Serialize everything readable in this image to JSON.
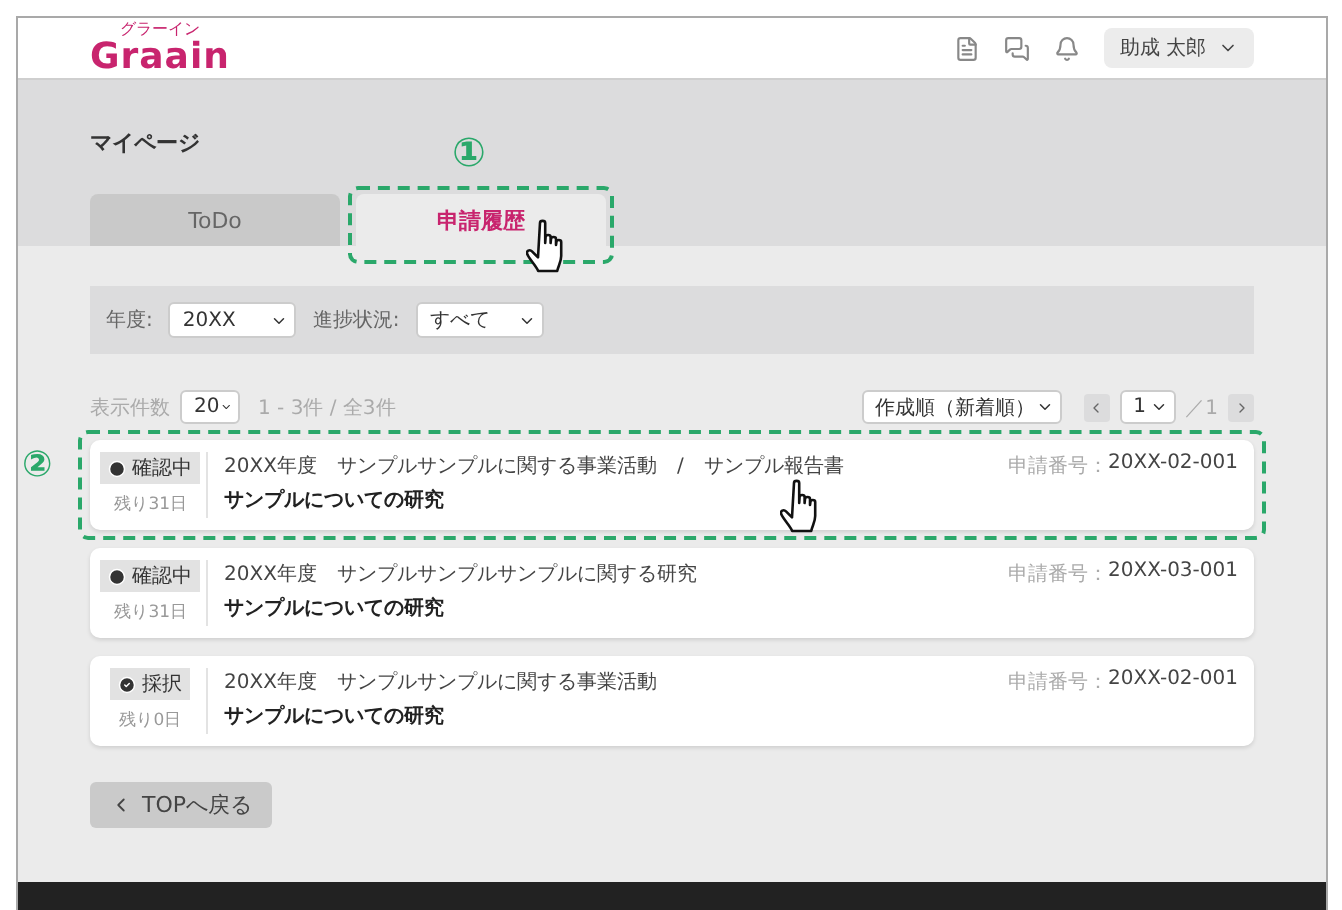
{
  "header": {
    "logo": "Graain",
    "logo_reading": "グラーイン",
    "user_menu": "助成 太郎"
  },
  "page_title": "マイページ",
  "tabs": [
    {
      "label": "ToDo",
      "selected": false
    },
    {
      "label": "申請履歴",
      "selected": true,
      "marker": "①"
    }
  ],
  "filters": [
    {
      "label": "年度:",
      "value": "20XX"
    },
    {
      "label": "進捗状況:",
      "value": "すべて"
    }
  ],
  "list_controls": {
    "per_page_label": "表示件数",
    "per_page": "20",
    "range": "1 - 3件 / 全3件",
    "sort": "作成順（新着順）",
    "page": "1",
    "page_total": "／1"
  },
  "applications": [
    {
      "kind": "pending",
      "status": "確認中",
      "remaining": "残り31日",
      "meta": [
        "20XX年度",
        "サンプルサンプルに関する事業活動",
        "/",
        "サンプル報告書"
      ],
      "title": "サンプルについての研究",
      "number_label": "申請番号：",
      "number": "20XX-02-001",
      "marker": "②"
    },
    {
      "kind": "pending",
      "status": "確認中",
      "remaining": "残り31日",
      "meta": [
        "20XX年度",
        "サンプルサンプルサンプルに関する研究"
      ],
      "title": "サンプルについての研究",
      "number_label": "申請番号：",
      "number": "20XX-03-001"
    },
    {
      "kind": "adopted",
      "status": "採択",
      "remaining": "残り0日",
      "meta": [
        "20XX年度",
        "サンプルサンプルに関する事業活動"
      ],
      "title": "サンプルについての研究",
      "number_label": "申請番号：",
      "number": "20XX-02-001"
    }
  ],
  "back_button": "TOPへ戻る"
}
